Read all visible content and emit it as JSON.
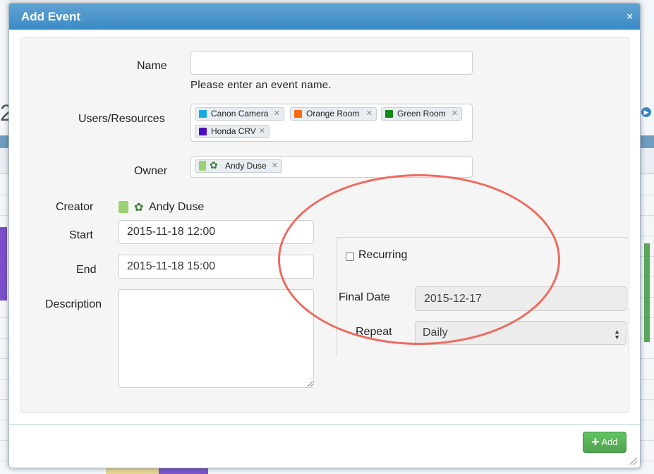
{
  "dialog": {
    "title": "Add Event",
    "close_label": "×"
  },
  "form": {
    "name_label": "Name",
    "name_value": "",
    "name_hint": "Please enter an event name.",
    "users_label": "Users/Resources",
    "resources": [
      {
        "label": "Canon Camera",
        "color": "#15a9e6"
      },
      {
        "label": "Orange Room",
        "color": "#f96a0e"
      },
      {
        "label": "Green Room",
        "color": "#138a13"
      },
      {
        "label": "Honda CRV",
        "color": "#4b0fc2"
      }
    ],
    "owner_label": "Owner",
    "owner_tag": {
      "label": "Andy Duse",
      "color": "#9cd26f"
    },
    "creator_label": "Creator",
    "creator_name": "Andy Duse",
    "creator_color": "#9cd26f",
    "start_label": "Start",
    "start_value": "2015-11-18 12:00",
    "end_label": "End",
    "end_value": "2015-11-18 15:00",
    "description_label": "Description",
    "description_value": "",
    "recurring_label": "Recurring",
    "recurring_checked": false,
    "final_date_label": "Final Date",
    "final_date_value": "2015-12-17",
    "repeat_label": "Repeat",
    "repeat_value": "Daily"
  },
  "footer": {
    "add_label": "Add"
  },
  "background": {
    "partial_text": "2"
  },
  "colors": {
    "header": "#3b8ac6",
    "add_button": "#51a351",
    "annotation": "#ef6a5e"
  }
}
